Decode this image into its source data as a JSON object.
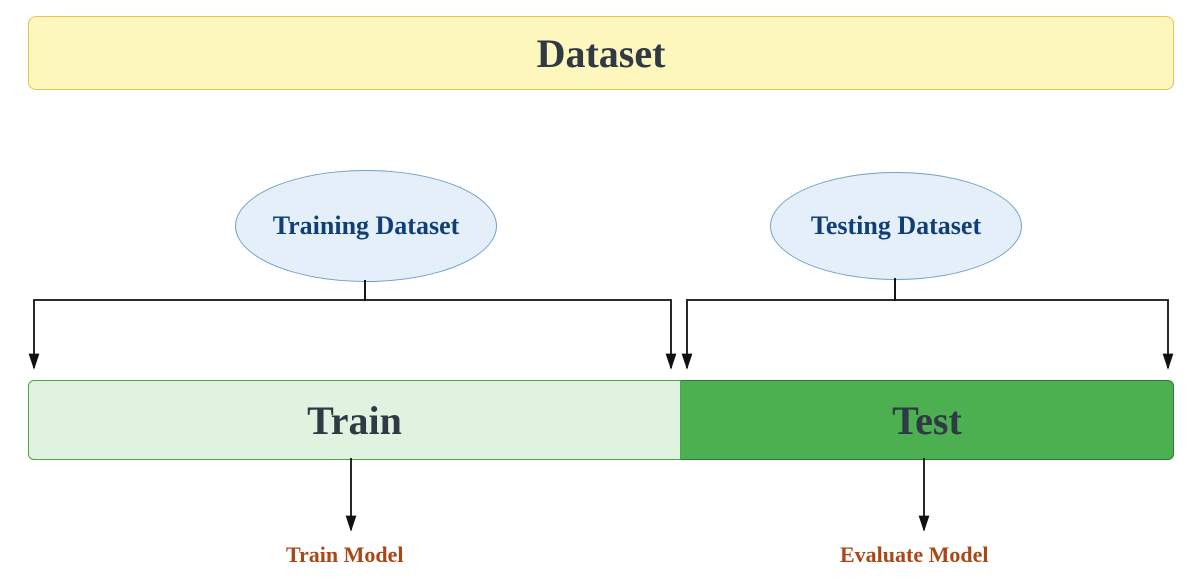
{
  "dataset": {
    "title": "Dataset"
  },
  "ellipses": {
    "training": "Training Dataset",
    "testing": "Testing Dataset"
  },
  "split": {
    "train_label": "Train",
    "test_label": "Test"
  },
  "captions": {
    "train": "Train Model",
    "evaluate": "Evaluate Model"
  },
  "colors": {
    "dataset_bg": "#fdf6bd",
    "dataset_border": "#e4c35a",
    "ellipse_bg": "#e4effa",
    "ellipse_border": "#6fa0c9",
    "ellipse_text": "#0f3f75",
    "train_bg": "#e0f3e0",
    "train_border": "#4aa74a",
    "test_bg": "#4caf50",
    "test_border": "#2f7a33",
    "caption_text": "#a94816",
    "arrow": "#111111"
  }
}
